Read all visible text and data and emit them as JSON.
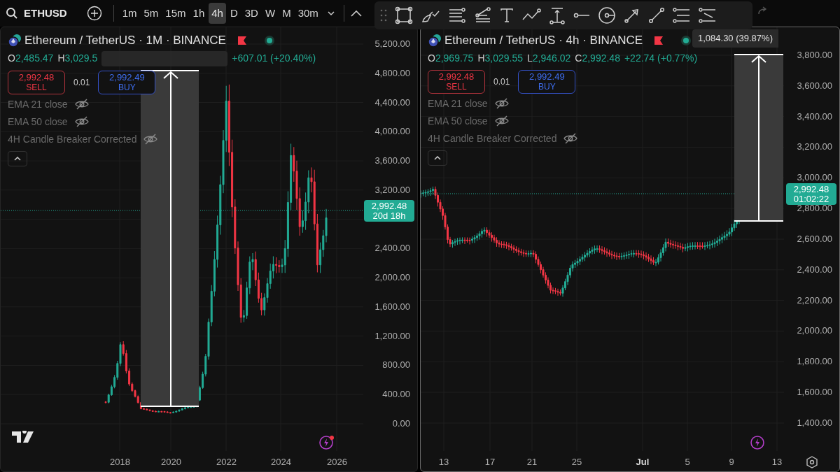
{
  "symbol": "ETHUSD",
  "intervals": [
    {
      "label": "1m",
      "selected": false
    },
    {
      "label": "5m",
      "selected": false
    },
    {
      "label": "15m",
      "selected": false
    },
    {
      "label": "1h",
      "selected": false
    },
    {
      "label": "4h",
      "selected": true
    },
    {
      "label": "D",
      "selected": false
    },
    {
      "label": "3D",
      "selected": false
    },
    {
      "label": "W",
      "selected": false
    },
    {
      "label": "M",
      "selected": false
    },
    {
      "label": "30m",
      "selected": false
    }
  ],
  "charts": [
    {
      "title": "Ethereum / TetherUS · 1M · BINANCE",
      "ohlc": [
        {
          "key": "O",
          "value": "2,485.47"
        },
        {
          "key": "H",
          "value": "3,029.5"
        }
      ],
      "change": "+607.01 (+20.40%)",
      "sell": {
        "price": "2,992.48",
        "label": "SELL"
      },
      "quantity": "0.01",
      "buy": {
        "price": "2,992.49",
        "label": "BUY"
      },
      "indicators": [
        {
          "label": "EMA 21 close",
          "hidden": true
        },
        {
          "label": "EMA 50 close",
          "hidden": true
        },
        {
          "label": "4H Candle Breaker Corrected",
          "hidden": true
        }
      ],
      "price_axis": [
        "5,200.00",
        "4,800.00",
        "4,400.00",
        "4,000.00",
        "3,600.00",
        "3,200.00",
        "2,400.00",
        "2,000.00",
        "1,600.00",
        "1,200.00",
        "800.00",
        "400.00",
        "0.00"
      ],
      "last_price": {
        "price": "2,992.48",
        "countdown": "20d 18h"
      },
      "time_axis": [
        "2018",
        "2020",
        "2022",
        "2024",
        "2026"
      ]
    },
    {
      "title": "Ethereum / TetherUS · 4h · BINANCE",
      "ohlc": [
        {
          "key": "O",
          "value": "2,969.75"
        },
        {
          "key": "H",
          "value": "3,029.55"
        },
        {
          "key": "L",
          "value": "2,946.02"
        },
        {
          "key": "C",
          "value": "2,992.48"
        }
      ],
      "change": "+22.74 (+0.77%)",
      "sell": {
        "price": "2,992.48",
        "label": "SELL"
      },
      "quantity": "0.01",
      "buy": {
        "price": "2,992.49",
        "label": "BUY"
      },
      "indicators": [
        {
          "label": "EMA 21 close",
          "hidden": true
        },
        {
          "label": "EMA 50 close",
          "hidden": true
        },
        {
          "label": "4H Candle Breaker Corrected",
          "hidden": true
        }
      ],
      "measure_label": "1,084.30 (39.87%)",
      "price_axis": [
        "3,800.00",
        "3,600.00",
        "3,400.00",
        "3,200.00",
        "3,000.00",
        "2,800.00",
        "2,600.00",
        "2,400.00",
        "2,200.00",
        "2,000.00",
        "1,800.00",
        "1,600.00",
        "1,400.00"
      ],
      "last_price": {
        "price": "2,992.48",
        "countdown": "01:02:22"
      },
      "time_axis": [
        "13",
        "17",
        "21",
        "25",
        "Jul",
        "5",
        "9",
        "13"
      ]
    }
  ]
}
